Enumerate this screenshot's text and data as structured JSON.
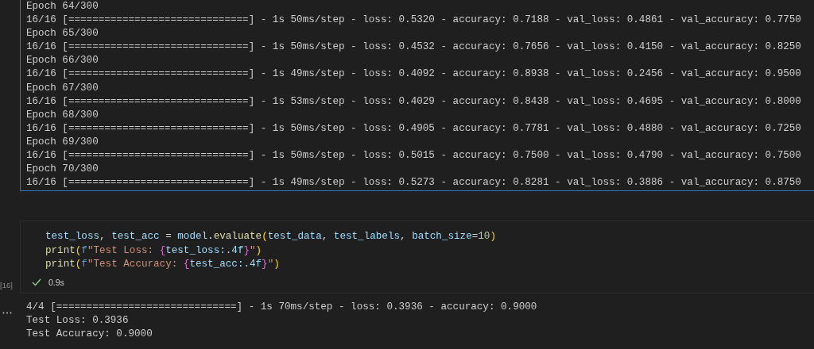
{
  "training_output": {
    "lines": [
      "Epoch 64/300",
      "16/16 [==============================] - 1s 50ms/step - loss: 0.5320 - accuracy: 0.7188 - val_loss: 0.4861 - val_accuracy: 0.7750",
      "Epoch 65/300",
      "16/16 [==============================] - 1s 50ms/step - loss: 0.4532 - accuracy: 0.7656 - val_loss: 0.4150 - val_accuracy: 0.8250",
      "Epoch 66/300",
      "16/16 [==============================] - 1s 49ms/step - loss: 0.4092 - accuracy: 0.8938 - val_loss: 0.2456 - val_accuracy: 0.9500",
      "Epoch 67/300",
      "16/16 [==============================] - 1s 53ms/step - loss: 0.4029 - accuracy: 0.8438 - val_loss: 0.4695 - val_accuracy: 0.8000",
      "Epoch 68/300",
      "16/16 [==============================] - 1s 50ms/step - loss: 0.4905 - accuracy: 0.7781 - val_loss: 0.4880 - val_accuracy: 0.7250",
      "Epoch 69/300",
      "16/16 [==============================] - 1s 50ms/step - loss: 0.5015 - accuracy: 0.7500 - val_loss: 0.4790 - val_accuracy: 0.7500",
      "Epoch 70/300",
      "16/16 [==============================] - 1s 49ms/step - loss: 0.5273 - accuracy: 0.8281 - val_loss: 0.3886 - val_accuracy: 0.8750"
    ]
  },
  "cell": {
    "execution_count": "[16]",
    "code_lines": [
      [
        {
          "kind": "var",
          "text": "test_loss"
        },
        {
          "kind": "plain",
          "text": ", "
        },
        {
          "kind": "var",
          "text": "test_acc"
        },
        {
          "kind": "plain",
          "text": " = "
        },
        {
          "kind": "var",
          "text": "model"
        },
        {
          "kind": "plain",
          "text": "."
        },
        {
          "kind": "func",
          "text": "evaluate"
        },
        {
          "kind": "paren",
          "text": "("
        },
        {
          "kind": "var",
          "text": "test_data"
        },
        {
          "kind": "plain",
          "text": ", "
        },
        {
          "kind": "var",
          "text": "test_labels"
        },
        {
          "kind": "plain",
          "text": ", "
        },
        {
          "kind": "var",
          "text": "batch_size"
        },
        {
          "kind": "plain",
          "text": "="
        },
        {
          "kind": "number",
          "text": "10"
        },
        {
          "kind": "paren",
          "text": ")"
        }
      ],
      [
        {
          "kind": "func",
          "text": "print"
        },
        {
          "kind": "paren",
          "text": "("
        },
        {
          "kind": "keyword",
          "text": "f"
        },
        {
          "kind": "string",
          "text": "\"Test Loss: "
        },
        {
          "kind": "brace",
          "text": "{"
        },
        {
          "kind": "var",
          "text": "test_loss"
        },
        {
          "kind": "var",
          "text": ":.4f"
        },
        {
          "kind": "brace",
          "text": "}"
        },
        {
          "kind": "string",
          "text": "\""
        },
        {
          "kind": "paren",
          "text": ")"
        }
      ],
      [
        {
          "kind": "func",
          "text": "print"
        },
        {
          "kind": "paren",
          "text": "("
        },
        {
          "kind": "keyword",
          "text": "f"
        },
        {
          "kind": "string",
          "text": "\"Test Accuracy: "
        },
        {
          "kind": "brace",
          "text": "{"
        },
        {
          "kind": "var",
          "text": "test_acc"
        },
        {
          "kind": "var",
          "text": ":.4f"
        },
        {
          "kind": "brace",
          "text": "}"
        },
        {
          "kind": "string",
          "text": "\""
        },
        {
          "kind": "paren",
          "text": ")"
        }
      ]
    ],
    "status": {
      "kind": "success",
      "duration": "0.9s"
    }
  },
  "cell_output": {
    "lines": [
      "4/4 [==============================] - 1s 70ms/step - loss: 0.3936 - accuracy: 0.9000",
      "Test Loss: 0.3936",
      "Test Accuracy: 0.9000"
    ]
  }
}
